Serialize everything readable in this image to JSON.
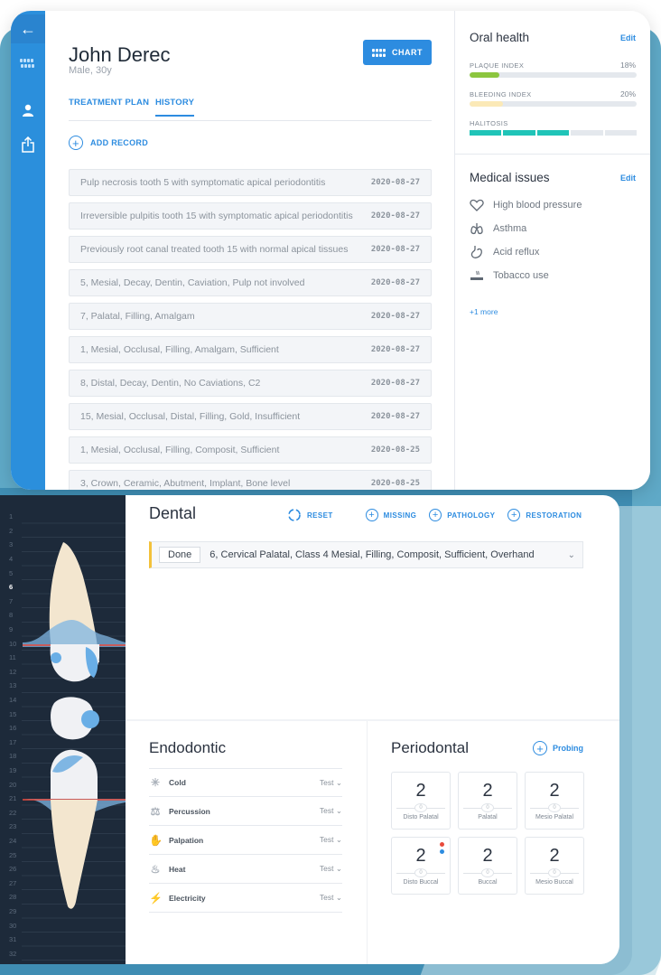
{
  "sidebar": {
    "back_icon": "arrow-left-icon",
    "items": [
      "teeth-icon",
      "user-icon",
      "share-icon"
    ]
  },
  "patient": {
    "name": "John Derec",
    "meta": "Male, 30y"
  },
  "chart_button": {
    "label": "CHART"
  },
  "tabs": [
    {
      "label": "TREATMENT PLAN"
    },
    {
      "label": "HISTORY"
    }
  ],
  "add_record": {
    "label": "ADD RECORD"
  },
  "records": [
    {
      "text": "Pulp necrosis tooth 5 with symptomatic apical periodontitis",
      "date": "2020-08-27"
    },
    {
      "text": "Irreversible pulpitis tooth 15 with symptomatic apical periodontitis",
      "date": "2020-08-27"
    },
    {
      "text": "Previously root canal treated tooth 15 with normal apical tissues",
      "date": "2020-08-27"
    },
    {
      "text": "5, Mesial, Decay, Dentin, Caviation, Pulp not involved",
      "date": "2020-08-27"
    },
    {
      "text": "7, Palatal, Filling, Amalgam",
      "date": "2020-08-27"
    },
    {
      "text": "1, Mesial, Occlusal, Filling, Amalgam, Sufficient",
      "date": "2020-08-27"
    },
    {
      "text": "8, Distal, Decay, Dentin, No Caviations, C2",
      "date": "2020-08-27"
    },
    {
      "text": "15, Mesial, Occlusal, Distal, Filling, Gold, Insufficient",
      "date": "2020-08-27"
    },
    {
      "text": "1, Mesial, Occlusal, Filling, Composit, Sufficient",
      "date": "2020-08-25"
    },
    {
      "text": "3, Crown, Ceramic, Abutment, Implant, Bone level",
      "date": "2020-08-25"
    }
  ],
  "oral_health": {
    "title": "Oral health",
    "edit": "Edit",
    "plaque": {
      "label": "PLAQUE INDEX",
      "value": "18%",
      "fraction": 0.18,
      "color": "#8cc63f"
    },
    "bleeding": {
      "label": "BLEEDING INDEX",
      "value": "20%",
      "fraction": 0.2,
      "color": "#fbe9b7"
    },
    "halitosis": {
      "label": "HALITOSIS",
      "segments_filled": 3,
      "segments_total": 5,
      "color": "#20c4b8"
    }
  },
  "medical": {
    "title": "Medical issues",
    "edit": "Edit",
    "items": [
      {
        "label": "High blood pressure",
        "icon": "heart-icon"
      },
      {
        "label": "Asthma",
        "icon": "lungs-icon"
      },
      {
        "label": "Acid reflux",
        "icon": "stomach-icon"
      },
      {
        "label": "Tobacco use",
        "icon": "cigarette-icon"
      }
    ],
    "more": "+1 more"
  },
  "tooth_numbers": [
    "1",
    "2",
    "3",
    "4",
    "5",
    "6",
    "7",
    "8",
    "9",
    "10",
    "11",
    "12",
    "13",
    "14",
    "15",
    "16",
    "17",
    "18",
    "19",
    "20",
    "21",
    "22",
    "23",
    "24",
    "25",
    "26",
    "27",
    "28",
    "29",
    "30",
    "31",
    "32"
  ],
  "dental": {
    "title": "Dental",
    "actions": [
      {
        "label": "RESET",
        "icon": "reset-icon"
      },
      {
        "label": "MISSING",
        "icon": "plus-circle-icon"
      },
      {
        "label": "PATHOLOGY",
        "icon": "plus-circle-icon"
      },
      {
        "label": "RESTORATION",
        "icon": "plus-circle-icon"
      }
    ],
    "done_badge": "Done",
    "done_text": "6, Cervical Palatal, Class 4 Mesial, Filling, Composit, Sufficient, Overhand"
  },
  "endodontic": {
    "title": "Endodontic",
    "rows": [
      {
        "label": "Cold",
        "value": "Test",
        "icon": "snowflake-icon"
      },
      {
        "label": "Percussion",
        "value": "Test",
        "icon": "percussion-icon"
      },
      {
        "label": "Palpation",
        "value": "Test",
        "icon": "palpation-icon"
      },
      {
        "label": "Heat",
        "value": "Test",
        "icon": "flame-icon"
      },
      {
        "label": "Electricity",
        "value": "Test",
        "icon": "bolt-icon"
      }
    ]
  },
  "periodontal": {
    "title": "Periodontal",
    "probing": "Probing",
    "cells": [
      {
        "value": "2",
        "label": "Disto Palatal",
        "marker": "0"
      },
      {
        "value": "2",
        "label": "Palatal",
        "marker": "0"
      },
      {
        "value": "2",
        "label": "Mesio Palatal",
        "marker": "0"
      },
      {
        "value": "2",
        "label": "Disto Buccal",
        "marker": "0",
        "dots": [
          "#e84b3c",
          "#2d8ce0"
        ]
      },
      {
        "value": "2",
        "label": "Buccal",
        "marker": "0"
      },
      {
        "value": "2",
        "label": "Mesio Buccal",
        "marker": "0"
      }
    ]
  },
  "colors": {
    "primary": "#2d8ce0",
    "sidebar": "#2b8fdc",
    "tooth_strip": "#1d2a3a",
    "highlight": "#f3c13a"
  }
}
